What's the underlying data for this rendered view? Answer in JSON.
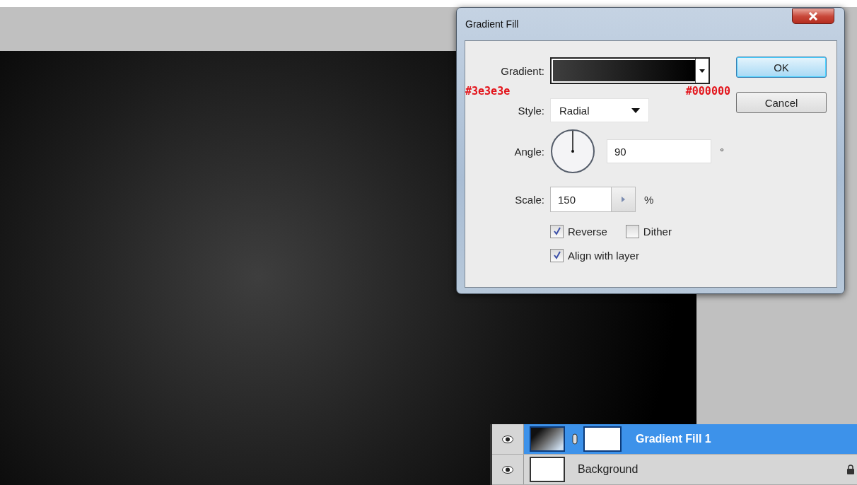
{
  "dialog": {
    "title": "Gradient Fill",
    "gradient": {
      "label": "Gradient:",
      "start_note": "#3e3e3e",
      "end_note": "#000000"
    },
    "style": {
      "label": "Style:",
      "value": "Radial"
    },
    "angle": {
      "label": "Angle:",
      "value": "90",
      "unit": "°"
    },
    "scale": {
      "label": "Scale:",
      "value": "150",
      "unit": "%"
    },
    "checkboxes": [
      {
        "label": "Reverse",
        "checked": true
      },
      {
        "label": "Dither",
        "checked": false
      },
      {
        "label": "Align with layer",
        "checked": true
      }
    ],
    "buttons": [
      {
        "label": "OK",
        "kind": "default"
      },
      {
        "label": "Cancel",
        "kind": "normal"
      }
    ]
  },
  "layers": [
    {
      "name": "Gradient Fill 1",
      "kind": "gradient",
      "selected": true
    },
    {
      "name": "Background",
      "kind": "background",
      "selected": false
    }
  ]
}
